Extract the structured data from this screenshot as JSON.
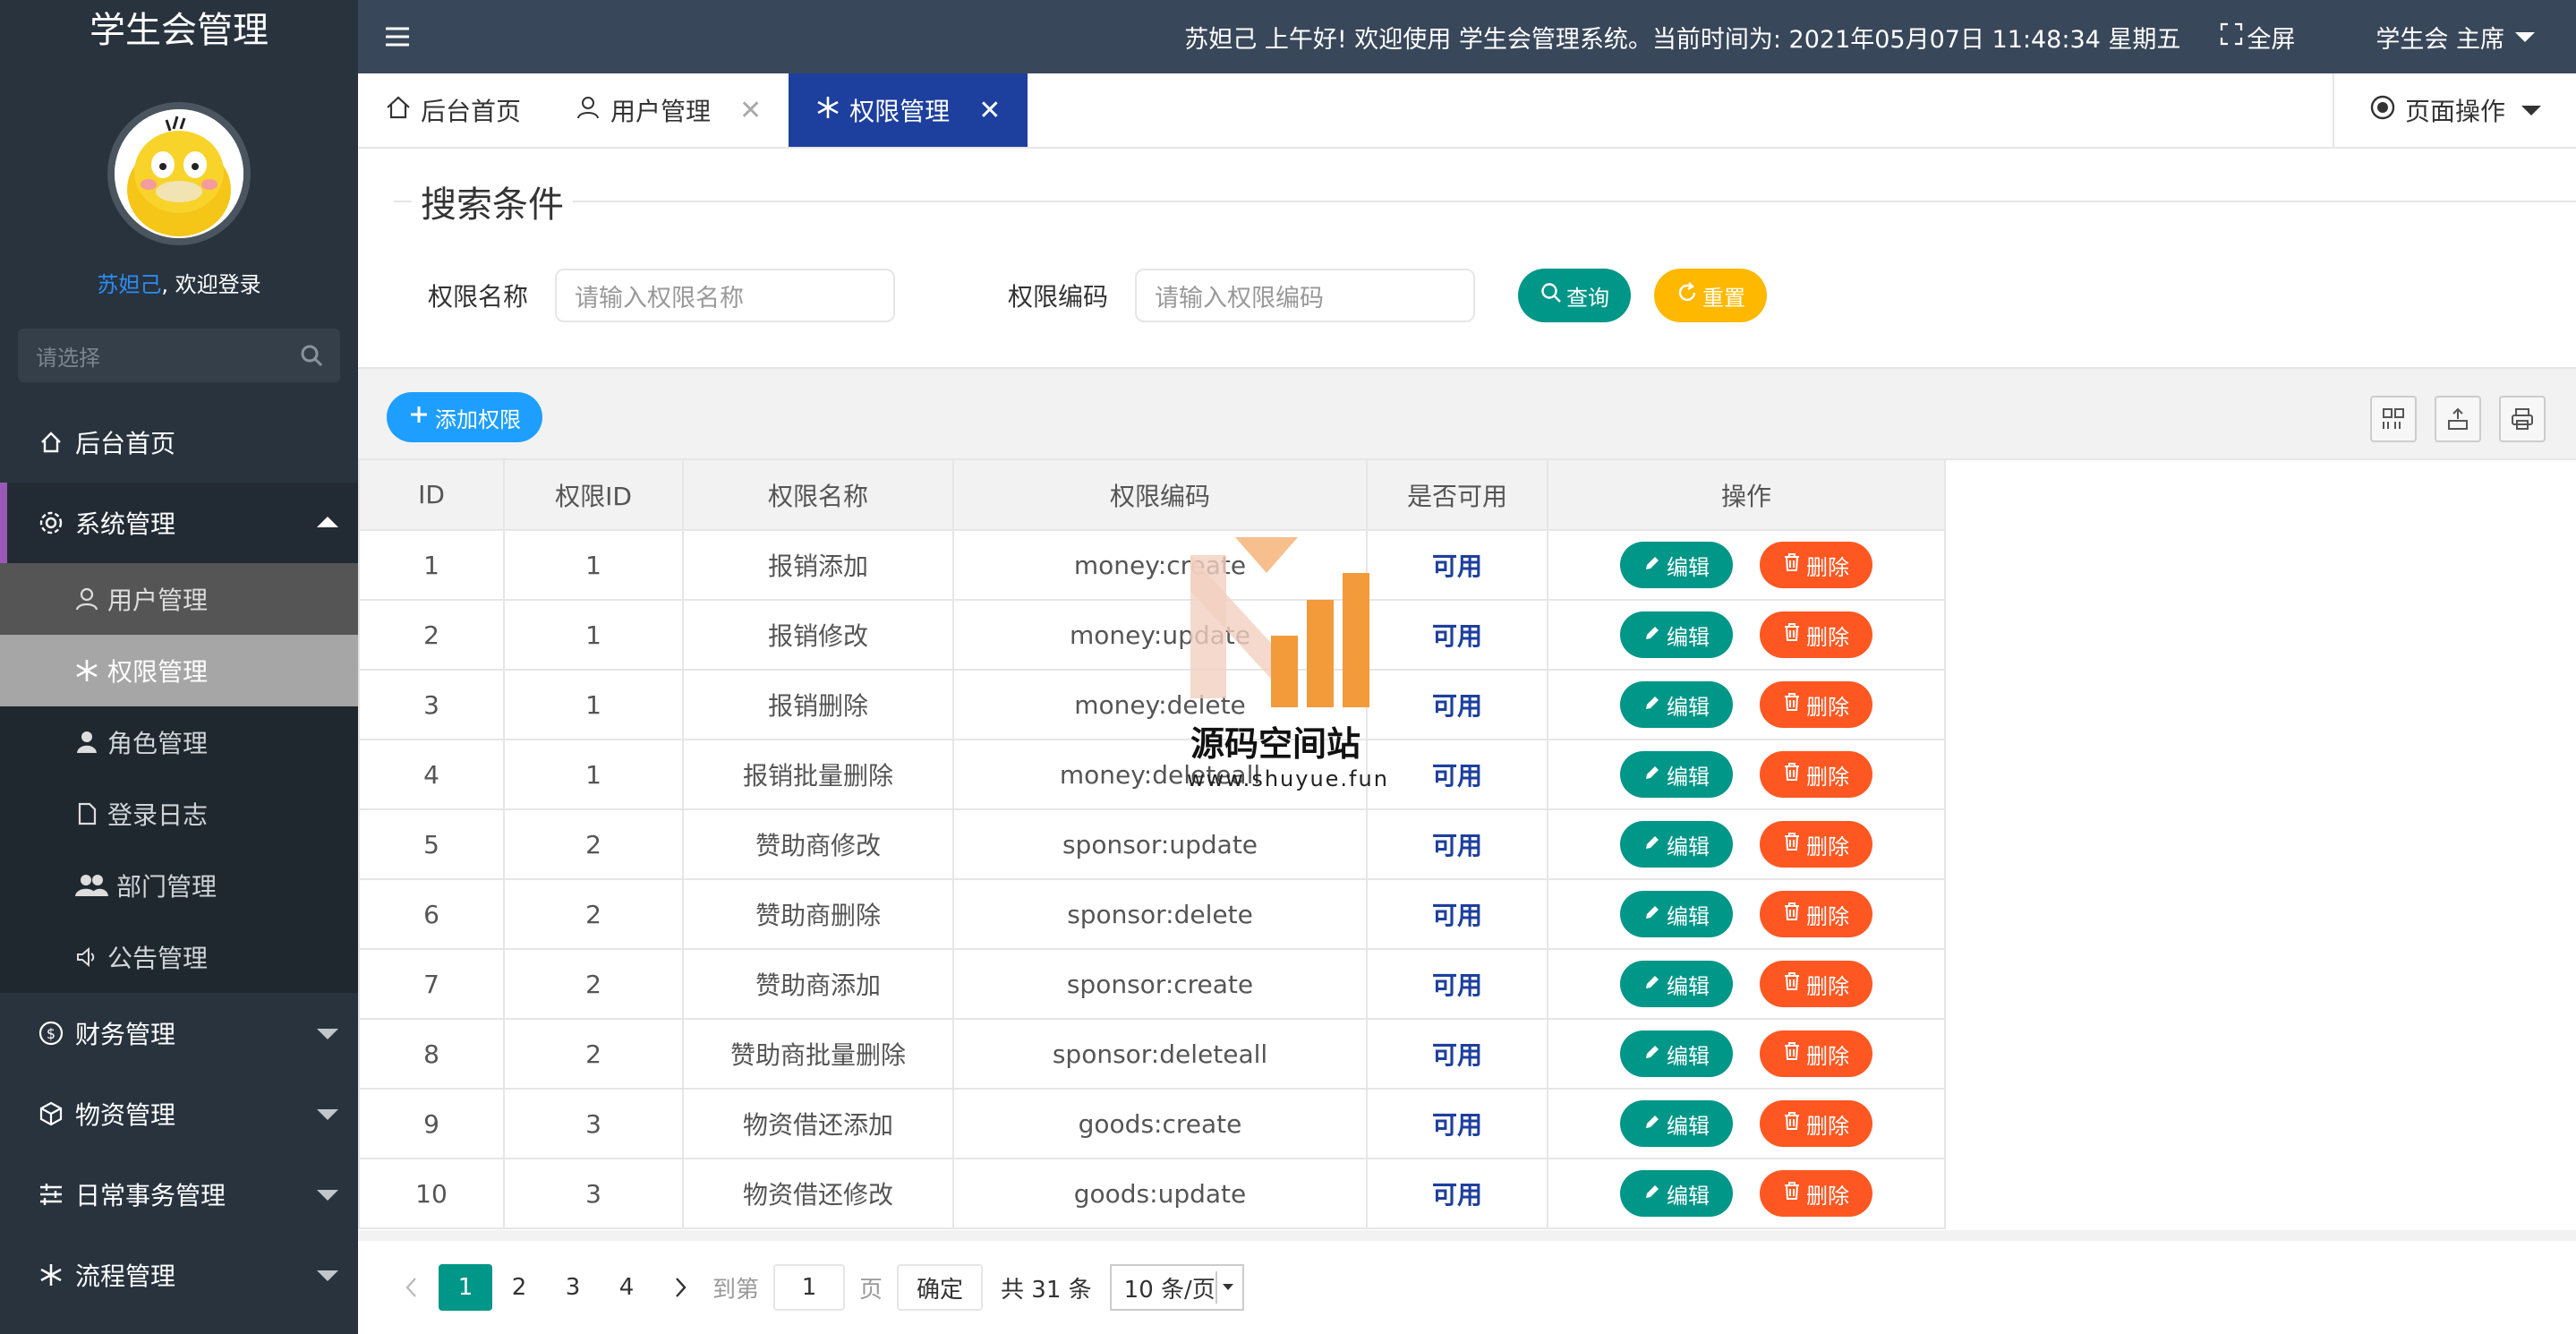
{
  "app": {
    "title": "学生会管理",
    "welcome_user": "苏妲己",
    "welcome_suffix": ", 欢迎登录",
    "side_search_placeholder": "请选择"
  },
  "sidebar": {
    "items": [
      {
        "label": "后台首页",
        "icon": "home-icon"
      },
      {
        "label": "系统管理",
        "icon": "gear-icon",
        "expanded": true,
        "children": [
          {
            "label": "用户管理",
            "icon": "user-icon"
          },
          {
            "label": "权限管理",
            "icon": "snowflake-icon",
            "current": true
          },
          {
            "label": "角色管理",
            "icon": "person-icon"
          },
          {
            "label": "登录日志",
            "icon": "file-icon"
          },
          {
            "label": "部门管理",
            "icon": "users-icon"
          },
          {
            "label": "公告管理",
            "icon": "speaker-icon"
          }
        ]
      },
      {
        "label": "财务管理",
        "icon": "dollar-icon"
      },
      {
        "label": "物资管理",
        "icon": "cube-icon"
      },
      {
        "label": "日常事务管理",
        "icon": "sliders-icon"
      },
      {
        "label": "流程管理",
        "icon": "snowflake-icon"
      }
    ]
  },
  "header": {
    "greeting": "苏妲己 上午好!  欢迎使用 学生会管理系统。当前时间为:  2021年05月07日 11:48:34   星期五",
    "fullscreen": "全屏",
    "user_role": "学生会 主席"
  },
  "tabs": [
    {
      "label": "后台首页",
      "icon": "home-icon",
      "closable": false
    },
    {
      "label": "用户管理",
      "icon": "user-icon",
      "closable": true
    },
    {
      "label": "权限管理",
      "icon": "snowflake-icon",
      "closable": true,
      "active": true
    }
  ],
  "page_ops": "页面操作",
  "search": {
    "title": "搜索条件",
    "name_label": "权限名称",
    "name_placeholder": "请输入权限名称",
    "code_label": "权限编码",
    "code_placeholder": "请输入权限编码",
    "query_label": "查询",
    "reset_label": "重置"
  },
  "toolbar": {
    "add_label": "添加权限"
  },
  "table": {
    "columns": [
      "ID",
      "权限ID",
      "权限名称",
      "权限编码",
      "是否可用",
      "操作"
    ],
    "edit_label": "编辑",
    "delete_label": "删除",
    "rows": [
      {
        "id": "1",
        "pid": "1",
        "name": "报销添加",
        "code": "money:create",
        "status": "可用"
      },
      {
        "id": "2",
        "pid": "1",
        "name": "报销修改",
        "code": "money:update",
        "status": "可用"
      },
      {
        "id": "3",
        "pid": "1",
        "name": "报销删除",
        "code": "money:delete",
        "status": "可用"
      },
      {
        "id": "4",
        "pid": "1",
        "name": "报销批量删除",
        "code": "money:deleteall",
        "status": "可用"
      },
      {
        "id": "5",
        "pid": "2",
        "name": "赞助商修改",
        "code": "sponsor:update",
        "status": "可用"
      },
      {
        "id": "6",
        "pid": "2",
        "name": "赞助商删除",
        "code": "sponsor:delete",
        "status": "可用"
      },
      {
        "id": "7",
        "pid": "2",
        "name": "赞助商添加",
        "code": "sponsor:create",
        "status": "可用"
      },
      {
        "id": "8",
        "pid": "2",
        "name": "赞助商批量删除",
        "code": "sponsor:deleteall",
        "status": "可用"
      },
      {
        "id": "9",
        "pid": "3",
        "name": "物资借还添加",
        "code": "goods:create",
        "status": "可用"
      },
      {
        "id": "10",
        "pid": "3",
        "name": "物资借还修改",
        "code": "goods:update",
        "status": "可用"
      }
    ]
  },
  "pager": {
    "pages": [
      "1",
      "2",
      "3",
      "4"
    ],
    "current": "1",
    "goto_label": "到第",
    "goto_value": "1",
    "page_unit": "页",
    "confirm_label": "确定",
    "total_label": "共 31 条",
    "size_label": "10 条/页"
  },
  "watermark": {
    "title": "源码空间站",
    "url": "www.shuyue.fun"
  },
  "colors": {
    "sidebar_bg": "#28333e",
    "header_bg": "#39475a",
    "active_tab": "#1d3f9e",
    "edit_button": "#009688",
    "delete_button": "#ff5722",
    "add_button": "#1e9fff",
    "reset_button": "#ffb800"
  }
}
